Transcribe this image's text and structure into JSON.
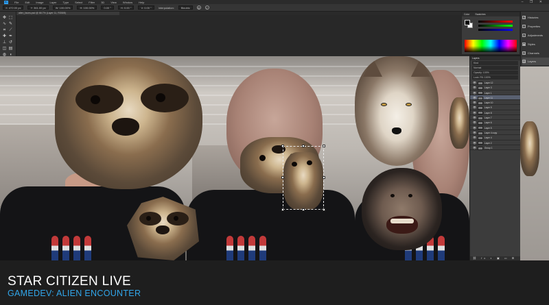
{
  "app": {
    "logo_text": "Ps",
    "menu": [
      "File",
      "Edit",
      "Image",
      "Layer",
      "Type",
      "Select",
      "Filter",
      "3D",
      "View",
      "Window",
      "Help"
    ],
    "window_controls": "– ❐ ✕"
  },
  "options_bar": {
    "fields": [
      "X: 472.00 px",
      "Y: 361.00 px",
      "W: 100.00%",
      "H: 100.00%",
      "0.00 °",
      "H: 0.00 °",
      "V: 0.00 °"
    ],
    "interpolation_label": "Interpolation:",
    "interpolation_value": "Bicubic"
  },
  "document_tab": {
    "label": "alien_faces.psd @ 66.7% (Layer 11, RGB/8)"
  },
  "color_panel": {
    "tabs": [
      "Color",
      "Swatches"
    ],
    "colors": {
      "fg": "#000000",
      "bg": "#ffffff"
    }
  },
  "right_dock": {
    "items": [
      {
        "icon": "history-icon",
        "label": "Histories"
      },
      {
        "icon": "properties-icon",
        "label": "Properties"
      },
      {
        "icon": "adjustments-icon",
        "label": "Adjustments"
      },
      {
        "icon": "styles-icon",
        "label": "Styles"
      },
      {
        "icon": "channels-icon",
        "label": "Channels"
      },
      {
        "icon": "layers-icon",
        "label": "Layers"
      }
    ]
  },
  "layers_panel": {
    "title": "Layers",
    "kind_filter": "Kind",
    "blend_mode": "Normal",
    "opacity": "Opacity: 100%",
    "lock_fill": "Lock:   Fill: 100%",
    "layers": [
      {
        "name": "Layer 12",
        "selected": false
      },
      {
        "name": "Layer 3",
        "selected": false
      },
      {
        "name": "Layer 1",
        "selected": false
      },
      {
        "name": "Layer 11",
        "selected": true
      },
      {
        "name": "Layer 10",
        "selected": false
      },
      {
        "name": "Layer 9",
        "selected": false
      },
      {
        "name": "Layer 8",
        "selected": false
      },
      {
        "name": "Layer 7",
        "selected": false
      },
      {
        "name": "Layer 6",
        "selected": false
      },
      {
        "name": "Layer 5",
        "selected": false
      },
      {
        "name": "Layer 4 copy",
        "selected": false
      },
      {
        "name": "Layer 4",
        "selected": false
      },
      {
        "name": "Layer 2",
        "selected": false
      },
      {
        "name": "Group 1",
        "selected": false
      }
    ],
    "footer_icons": "⛓ fx ◐ ▣ ▭ ⊞ 🗑"
  },
  "overlay": {
    "title": "STAR CITIZEN LIVE",
    "subtitle": "GAMEDEV: ALIEN ENCOUNTER",
    "title_color": "#ffffff",
    "subtitle_color": "#31a6ea"
  }
}
